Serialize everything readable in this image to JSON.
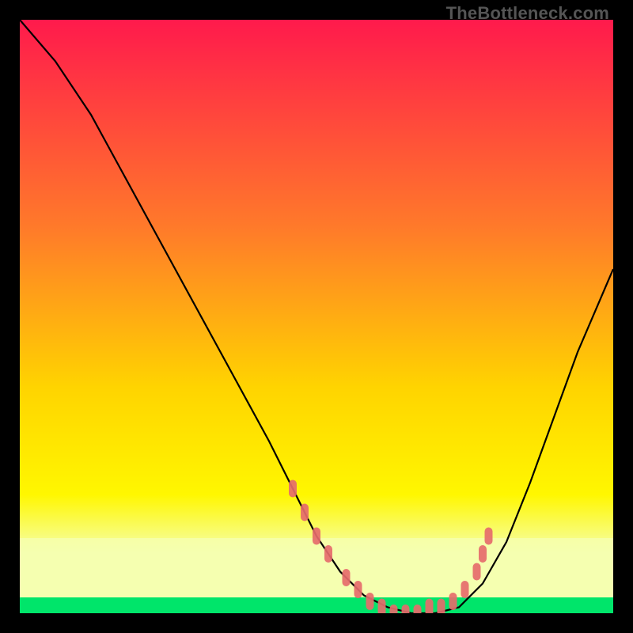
{
  "watermark": "TheBottleneck.com",
  "colors": {
    "gradient_top": "#ff1a4c",
    "gradient_mid1": "#ff7a2a",
    "gradient_mid2": "#ffd400",
    "gradient_mid3": "#fff700",
    "gradient_bottom_band": "#f5ffb0",
    "green_band": "#00e56a",
    "curve": "#000000",
    "dots": "#e56b6b",
    "frame": "#000000"
  },
  "chart_data": {
    "type": "line",
    "title": "",
    "xlabel": "",
    "ylabel": "",
    "xlim": [
      0,
      100
    ],
    "ylim": [
      0,
      100
    ],
    "series": [
      {
        "name": "bottleneck-curve",
        "x": [
          0,
          6,
          12,
          18,
          24,
          30,
          36,
          42,
          46,
          50,
          54,
          58,
          62,
          66,
          70,
          74,
          78,
          82,
          86,
          90,
          94,
          100
        ],
        "y": [
          100,
          93,
          84,
          73,
          62,
          51,
          40,
          29,
          21,
          13,
          7,
          3,
          1,
          0,
          0,
          1,
          5,
          12,
          22,
          33,
          44,
          58
        ]
      }
    ],
    "highlight_points": {
      "name": "highlight-dots",
      "x": [
        46,
        48,
        50,
        52,
        55,
        57,
        59,
        61,
        63,
        65,
        67,
        69,
        71,
        73,
        75,
        77,
        78,
        79
      ],
      "y": [
        21,
        17,
        13,
        10,
        6,
        4,
        2,
        1,
        0,
        0,
        0,
        1,
        1,
        2,
        4,
        7,
        10,
        13
      ]
    }
  }
}
